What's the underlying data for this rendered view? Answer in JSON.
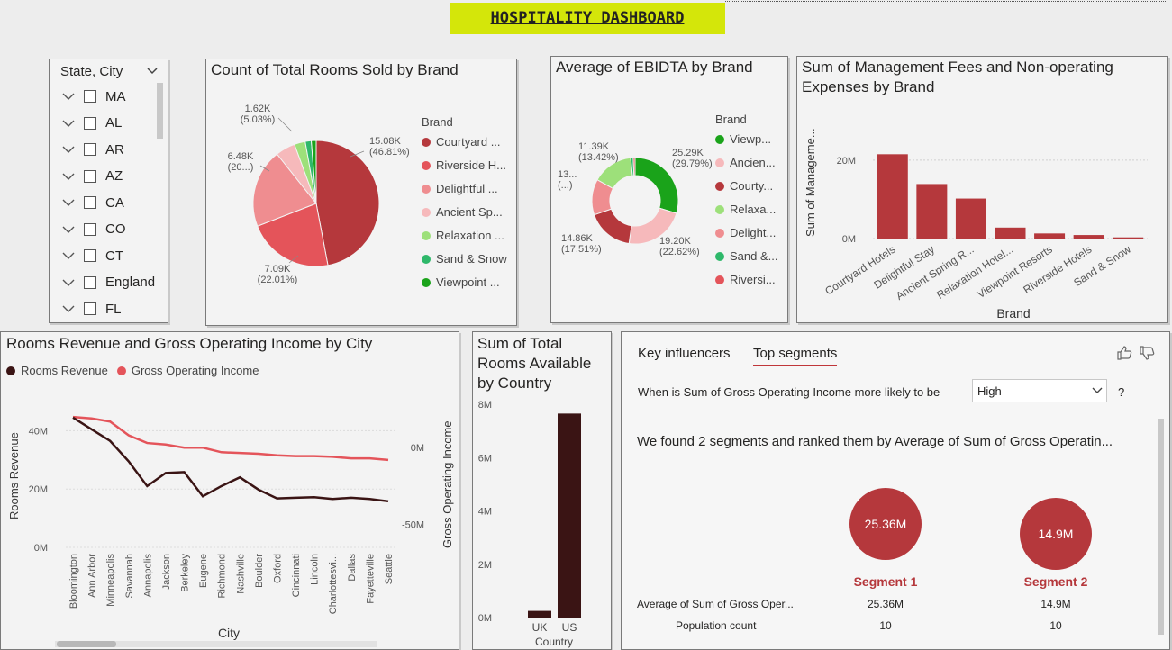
{
  "dashboard_title": "HOSPITALITY DASHBOARD",
  "colors": {
    "accent": "#c0363a",
    "title_bg": "#d4e60a",
    "dark_bar": "#3a1414"
  },
  "slicer": {
    "title": "State, City",
    "items": [
      "MA",
      "AL",
      "AR",
      "AZ",
      "CA",
      "CO",
      "CT",
      "England",
      "FL"
    ]
  },
  "pie": {
    "title": "Count of Total Rooms Sold by Brand",
    "legend_title": "Brand",
    "legend": [
      {
        "label": "Courtyard ...",
        "color": "#b5383c"
      },
      {
        "label": "Riverside H...",
        "color": "#e4545a"
      },
      {
        "label": "Delightful ...",
        "color": "#ef8d90"
      },
      {
        "label": "Ancient Sp...",
        "color": "#f6b9bb"
      },
      {
        "label": "Relaxation ...",
        "color": "#9de07a"
      },
      {
        "label": "Sand & Snow",
        "color": "#2eb86a"
      },
      {
        "label": "Viewpoint ...",
        "color": "#1aa31a"
      }
    ],
    "labels": [
      {
        "value": "15.08K",
        "pct": "(46.81%)"
      },
      {
        "value": "7.09K",
        "pct": "(22.01%)"
      },
      {
        "value": "6.48K",
        "pct": "(20...)"
      },
      {
        "value": "1.62K",
        "pct": "(5.03%)"
      }
    ]
  },
  "donut": {
    "title": "Average of EBIDTA by Brand",
    "legend_title": "Brand",
    "legend": [
      {
        "label": "Viewp...",
        "color": "#1aa31a"
      },
      {
        "label": "Ancien...",
        "color": "#f6b9bb"
      },
      {
        "label": "Courty...",
        "color": "#b5383c"
      },
      {
        "label": "Relaxa...",
        "color": "#9de07a"
      },
      {
        "label": "Delight...",
        "color": "#ef8d90"
      },
      {
        "label": "Sand &...",
        "color": "#2eb86a"
      },
      {
        "label": "Riversi...",
        "color": "#e4545a"
      }
    ],
    "labels": [
      {
        "value": "25.29K",
        "pct": "(29.79%)"
      },
      {
        "value": "19.20K",
        "pct": "(22.62%)"
      },
      {
        "value": "14.86K",
        "pct": "(17.51%)"
      },
      {
        "value": "13...",
        "pct": "(...)"
      },
      {
        "value": "11.39K",
        "pct": "(13.42%)"
      }
    ]
  },
  "mgmt": {
    "title_line1": "Sum of Management Fees and Non-operating",
    "title_line2": "Expenses by Brand",
    "ylabel": "Sum of Manageme...",
    "xlabel": "Brand",
    "yticks": [
      "20M",
      "0M"
    ]
  },
  "line_chart": {
    "title": "Rooms Revenue and Gross Operating Income by City",
    "legend": [
      {
        "label": "Rooms Revenue",
        "color": "#3a1414"
      },
      {
        "label": "Gross Operating Income",
        "color": "#e4545a"
      }
    ],
    "ylabel_left": "Rooms Revenue",
    "ylabel_right": "Gross Operating Income",
    "xlabel": "City",
    "yticks_left": [
      "40M",
      "20M",
      "0M"
    ],
    "yticks_right": [
      "0M",
      "-50M"
    ]
  },
  "country_chart": {
    "title_line1": "Sum of Total",
    "title_line2": "Rooms Available",
    "title_line3": "by Country",
    "yticks": [
      "8M",
      "6M",
      "4M",
      "2M",
      "0M"
    ],
    "xlabel": "Country"
  },
  "influencers": {
    "tab1": "Key influencers",
    "tab2": "Top segments",
    "question": "When is Sum of Gross Operating Income more likely to be",
    "dropdown_value": "High",
    "question_mark": "?",
    "found_text": "We found 2 segments and ranked them by Average of Sum of Gross Operatin...",
    "row1_label": "Average of Sum of Gross Oper...",
    "row2_label": "Population count",
    "segments": [
      {
        "bubble": "25.36M",
        "name": "Segment 1",
        "avg": "25.36M",
        "count": "10"
      },
      {
        "bubble": "14.9M",
        "name": "Segment 2",
        "avg": "14.9M",
        "count": "10"
      }
    ]
  },
  "chart_data": [
    {
      "type": "pie",
      "title": "Count of Total Rooms Sold by Brand",
      "categories": [
        "Courtyard Hotels",
        "Riverside Hotels",
        "Delightful Stay",
        "Ancient Spring Resorts",
        "Relaxation Hotels",
        "Sand & Snow",
        "Viewpoint Resorts"
      ],
      "values": [
        15.08,
        7.09,
        6.48,
        1.62,
        0.9,
        0.5,
        0.4
      ],
      "unit": "K"
    },
    {
      "type": "pie",
      "title": "Average of EBIDTA by Brand",
      "categories": [
        "Viewpoint Resorts",
        "Ancient Spring Resorts",
        "Courtyard Hotels",
        "Relaxation Hotels",
        "Delightful Stay",
        "Sand & Snow",
        "Riverside Hotels"
      ],
      "values": [
        25.29,
        19.2,
        14.86,
        13.0,
        11.39,
        0.8,
        0.6
      ],
      "unit": "K"
    },
    {
      "type": "bar",
      "title": "Sum of Management Fees and Non-operating Expenses by Brand",
      "categories": [
        "Courtyard Hotels",
        "Delightful Stay",
        "Ancient Spring R...",
        "Relaxation Hotel...",
        "Viewpoint Resorts",
        "Riverside Hotels",
        "Sand & Snow"
      ],
      "values": [
        21.5,
        13.9,
        10.2,
        2.8,
        1.3,
        0.9,
        0.3
      ],
      "ylim": [
        0,
        28
      ],
      "unit": "M"
    },
    {
      "type": "line",
      "title": "Rooms Revenue and Gross Operating Income by City",
      "categories": [
        "Bloomington",
        "Ann Arbor",
        "Minneapolis",
        "Savannah",
        "Annapolis",
        "Jackson",
        "Berkeley",
        "Eugene",
        "Richmond",
        "Nashville",
        "Boulder",
        "Oxford",
        "Cincinnati",
        "Lincoln",
        "Charlottesvi...",
        "Dallas",
        "Fayetteville",
        "Seattle"
      ],
      "series": [
        {
          "name": "Rooms Revenue",
          "values": [
            44.5,
            40.5,
            36.5,
            29.5,
            21.0,
            25.5,
            25.8,
            17.5,
            21.0,
            24.0,
            19.8,
            16.8,
            17.0,
            17.2,
            16.6,
            17.0,
            16.6,
            15.8
          ],
          "ylim": [
            0,
            50
          ]
        },
        {
          "name": "Gross Operating Income",
          "values": [
            20,
            19,
            17,
            8,
            3,
            2,
            0,
            0,
            -3,
            -3.5,
            -4,
            -5,
            -5.5,
            -5.5,
            -6,
            -7,
            -7,
            -8
          ],
          "ylim": [
            -65,
            40
          ]
        }
      ]
    },
    {
      "type": "bar",
      "title": "Sum of Total Rooms Available by Country",
      "categories": [
        "UK",
        "US"
      ],
      "values": [
        0.25,
        7.65
      ],
      "ylim": [
        0,
        8.4
      ],
      "unit": "M"
    }
  ]
}
